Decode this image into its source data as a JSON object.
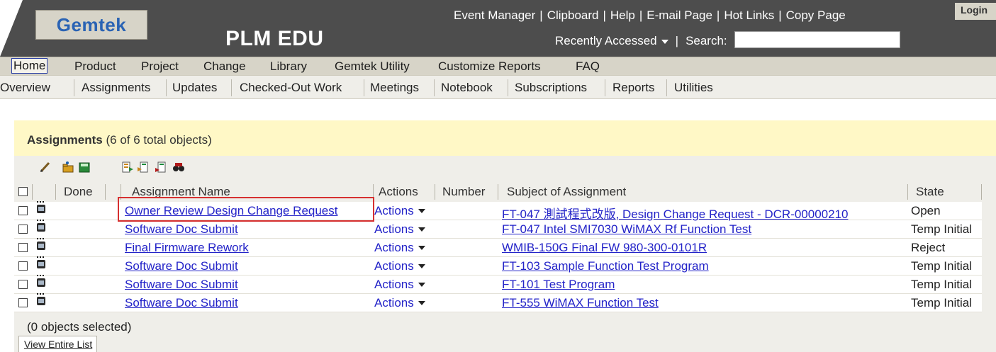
{
  "header": {
    "logo": "Gemtek",
    "app_title": "PLM EDU",
    "top_links": [
      "Event Manager",
      "Clipboard",
      "Help",
      "E-mail Page",
      "Hot Links",
      "Copy Page"
    ],
    "login": "Login",
    "recently_accessed": "Recently Accessed",
    "search_label": "Search:",
    "search_value": ""
  },
  "menubar": {
    "items": [
      "Home",
      "Product",
      "Project",
      "Change",
      "Library",
      "Gemtek Utility",
      "Customize Reports",
      "FAQ"
    ],
    "active": "Home"
  },
  "subnav": {
    "items": [
      "Overview",
      "Assignments",
      "Updates",
      "Checked-Out Work",
      "Meetings",
      "Notebook",
      "Subscriptions",
      "Reports",
      "Utilities"
    ]
  },
  "panel": {
    "title": "Assignments",
    "count_text": "(6 of 6 total objects)",
    "toolbar_icons": [
      "edit-icon",
      "create-folder-icon",
      "save-icon",
      "export-icon",
      "import-icon",
      "move-icon",
      "find-icon"
    ],
    "columns": [
      "Done",
      "Assignment Name",
      "Actions",
      "Number",
      "Subject of Assignment",
      "State"
    ],
    "rows": [
      {
        "name": "Owner Review Design Change Request",
        "actions": "Actions",
        "number": "",
        "subject": "FT-047 測試程式改版, Design Change Request - DCR-00000210",
        "state": "Open"
      },
      {
        "name": "Software Doc Submit",
        "actions": "Actions",
        "number": "",
        "subject": "FT-047 Intel SMI7030 WiMAX Rf Function Test",
        "state": "Temp Initial"
      },
      {
        "name": "Final Firmware Rework",
        "actions": "Actions",
        "number": "",
        "subject": "WMIB-150G Final FW 980-300-0101R",
        "state": "Reject"
      },
      {
        "name": "Software Doc Submit",
        "actions": "Actions",
        "number": "",
        "subject": "FT-103 Sample Function Test Program",
        "state": "Temp Initial"
      },
      {
        "name": "Software Doc Submit",
        "actions": "Actions",
        "number": "",
        "subject": "FT-101 Test Program",
        "state": "Temp Initial"
      },
      {
        "name": "Software Doc Submit",
        "actions": "Actions",
        "number": "",
        "subject": "FT-555 WiMAX Function Test",
        "state": "Temp Initial"
      }
    ],
    "selection_text": "(0 objects selected)",
    "view_all": "View Entire List"
  },
  "colors": {
    "header_bg": "#4d4d4d",
    "menubar_bg": "#d7d4c8",
    "panel_head_bg": "#fff8c6",
    "link": "#2323c8",
    "highlight": "#d63030"
  }
}
